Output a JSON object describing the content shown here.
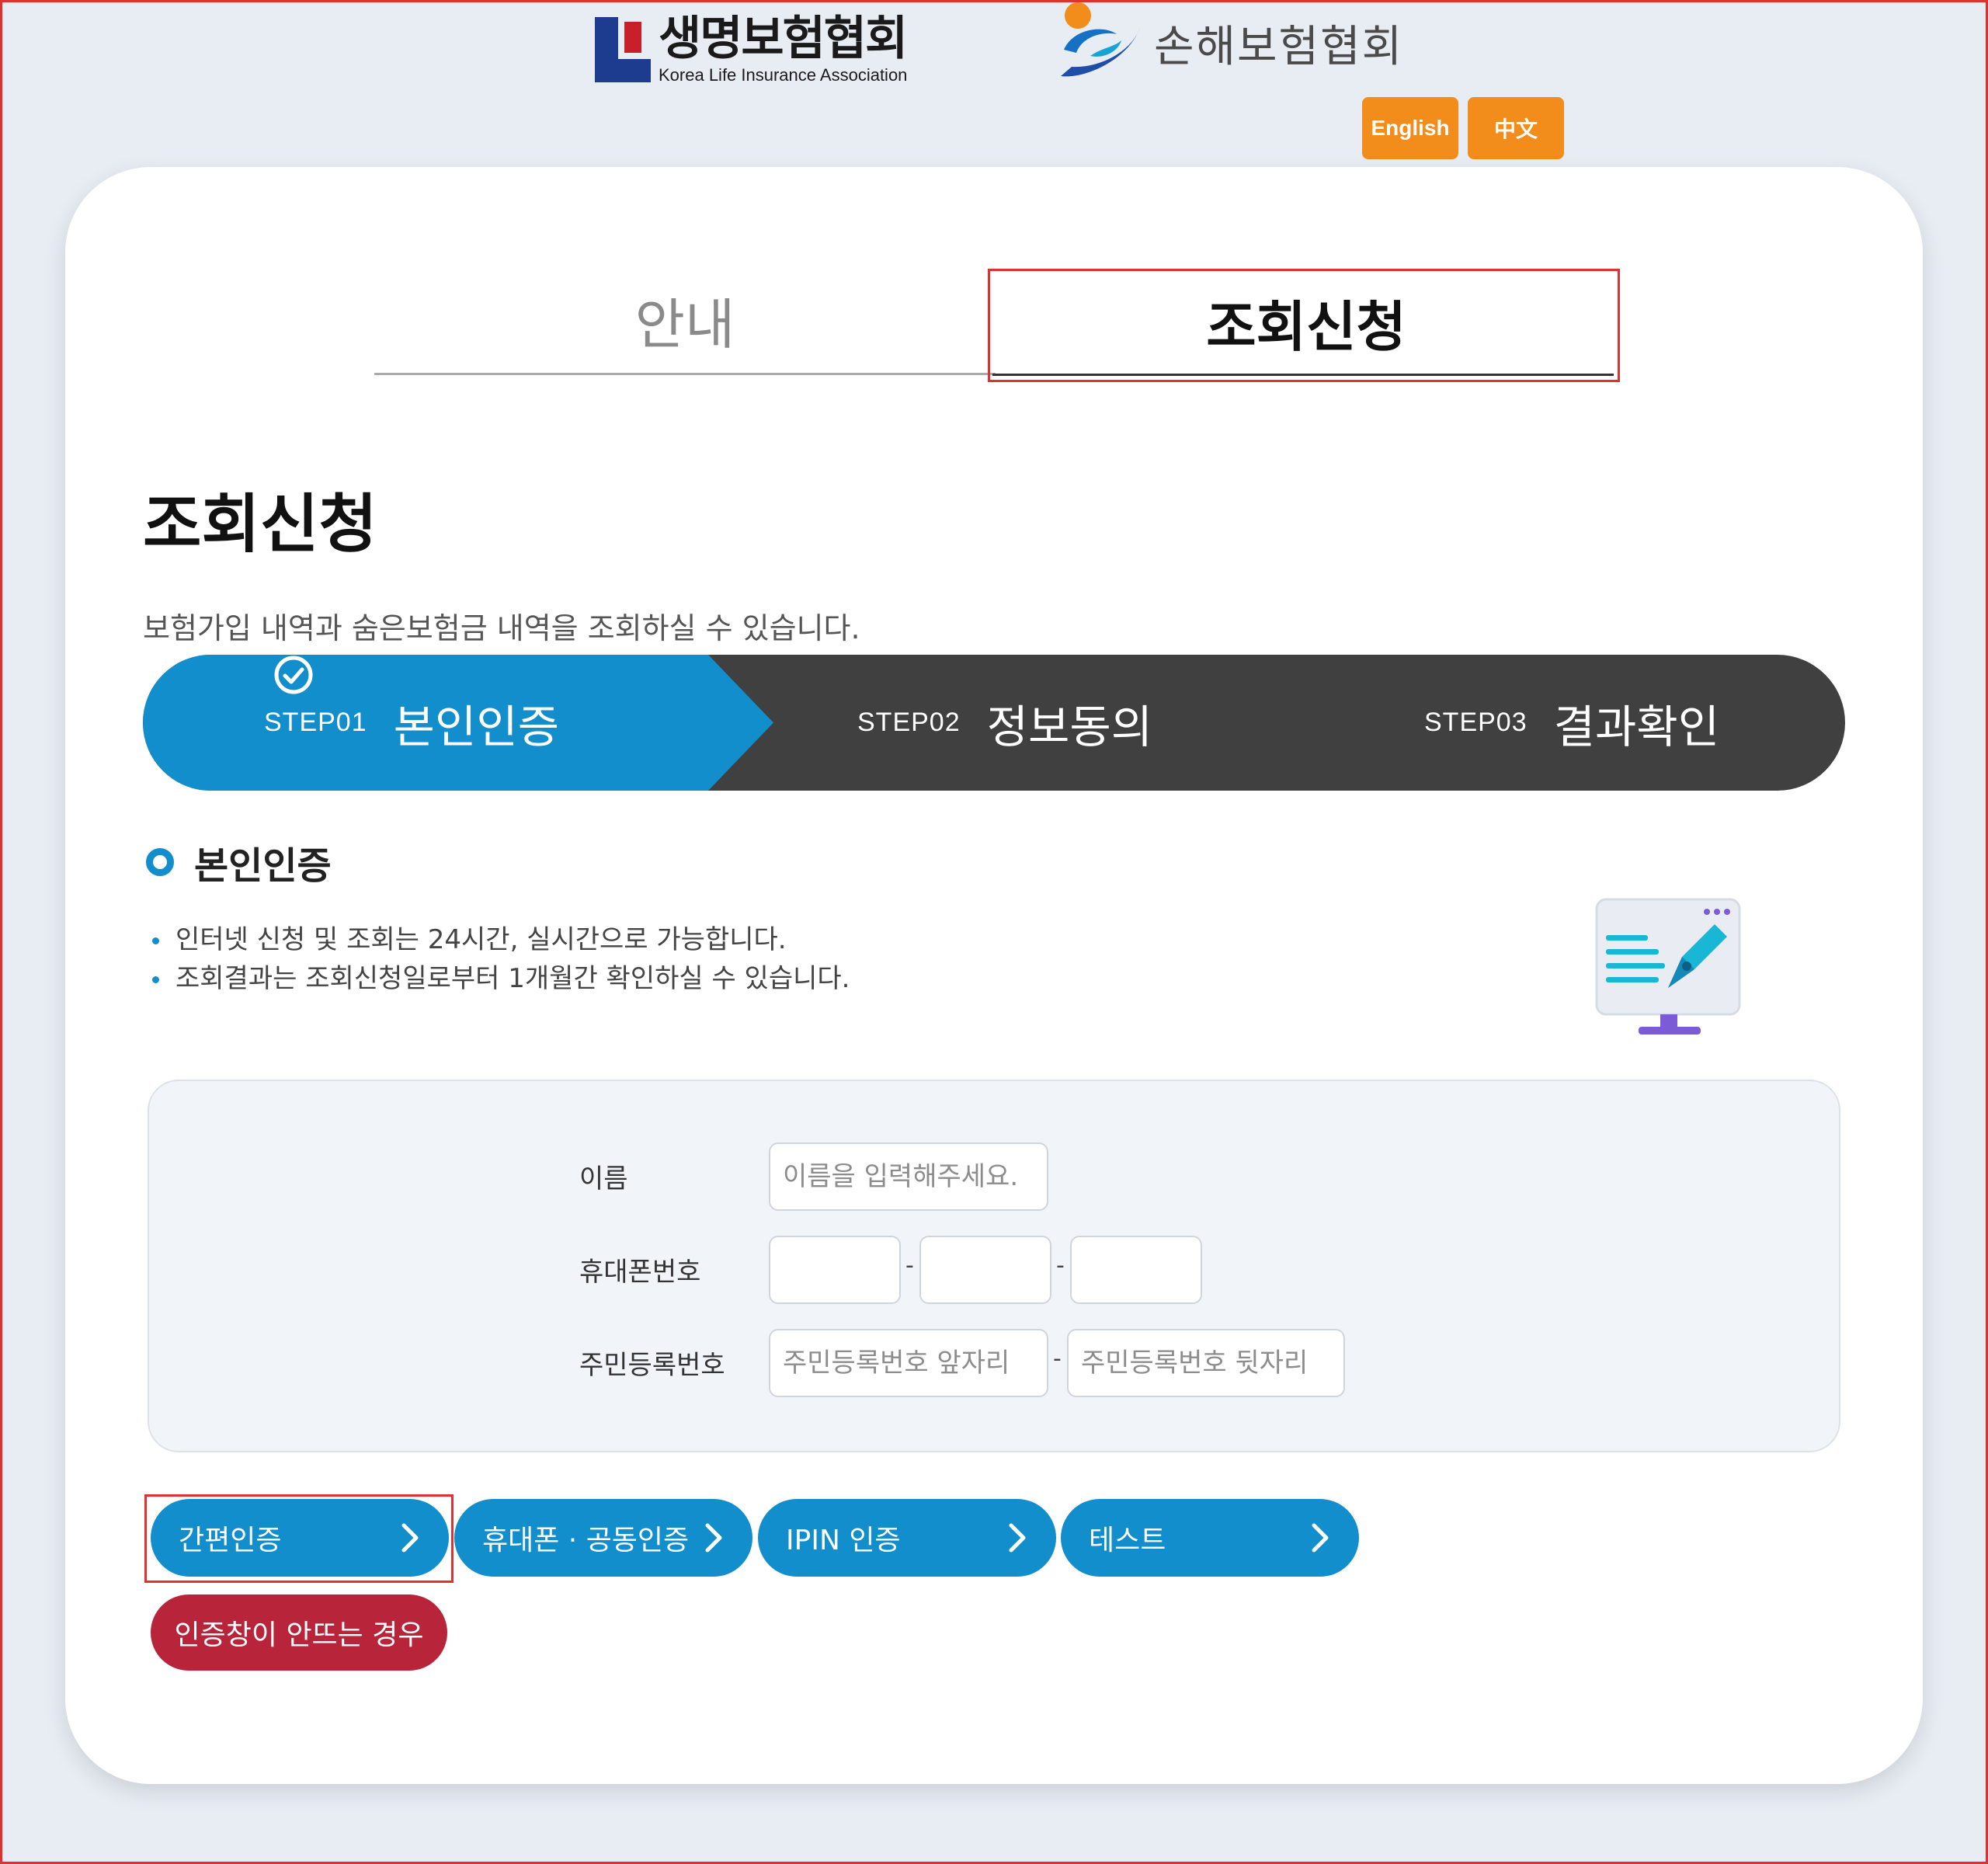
{
  "header": {
    "life_logo_kor": "생명보험협회",
    "life_logo_eng": "Korea Life Insurance Association",
    "nonlife_logo_kor": "손해보험협회",
    "lang_en": "English",
    "lang_zh": "中文"
  },
  "tabs": {
    "guide": "안내",
    "apply": "조회신청"
  },
  "page": {
    "title": "조회신청",
    "description": "보험가입 내역과 숨은보험금 내역을 조회하실 수 있습니다."
  },
  "steps": [
    {
      "num": "STEP01",
      "name": "본인인증"
    },
    {
      "num": "STEP02",
      "name": "정보동의"
    },
    {
      "num": "STEP03",
      "name": "결과확인"
    }
  ],
  "section": {
    "title": "본인인증",
    "bullets": [
      "인터넷 신청 및 조회는 24시간, 실시간으로 가능합니다.",
      "조회결과는 조회신청일로부터 1개월간 확인하실 수 있습니다."
    ]
  },
  "form": {
    "name_label": "이름",
    "name_placeholder": "이름을 입력해주세요.",
    "phone_label": "휴대폰번호",
    "rrn_label": "주민등록번호",
    "rrn_front_placeholder": "주민등록번호 앞자리",
    "rrn_back_placeholder": "주민등록번호 뒷자리",
    "sep": "-"
  },
  "buttons": {
    "simple_auth": "간편인증",
    "phone_auth": "휴대폰 · 공동인증",
    "ipin_auth": "IPIN 인증",
    "test": "테스트",
    "help": "인증창이 안뜨는 경우"
  },
  "colors": {
    "accent": "#118ecb",
    "step_dark": "#404040",
    "lang_orange": "#f28c1a",
    "help_red": "#b8243a"
  }
}
